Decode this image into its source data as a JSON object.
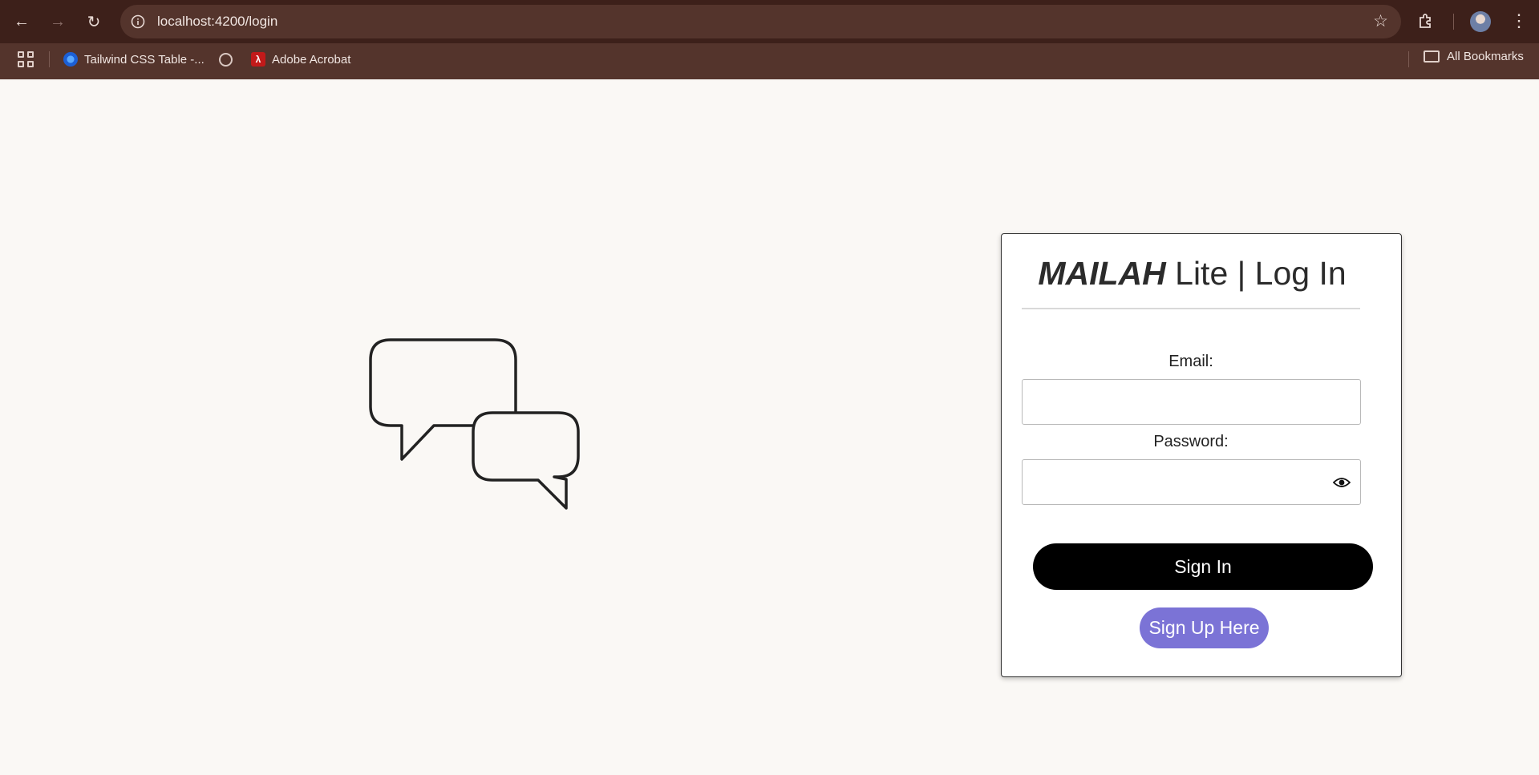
{
  "browser": {
    "url": "localhost:4200/login",
    "bookmarks": [
      {
        "label": "Tailwind CSS Table -..."
      },
      {
        "label": ""
      },
      {
        "label": "Adobe Acrobat"
      }
    ],
    "all_bookmarks_label": "All Bookmarks"
  },
  "login": {
    "title_brand": "MAILAH",
    "title_rest": " Lite | Log In",
    "email_label": "Email:",
    "email_value": "",
    "password_label": "Password:",
    "password_value": "",
    "signin_label": "Sign In",
    "signup_label": "Sign Up Here"
  },
  "colors": {
    "page_bg": "#faf8f5",
    "chrome_bg": "#54342c",
    "signin_bg": "#000000",
    "signup_bg": "#7b73d6"
  }
}
